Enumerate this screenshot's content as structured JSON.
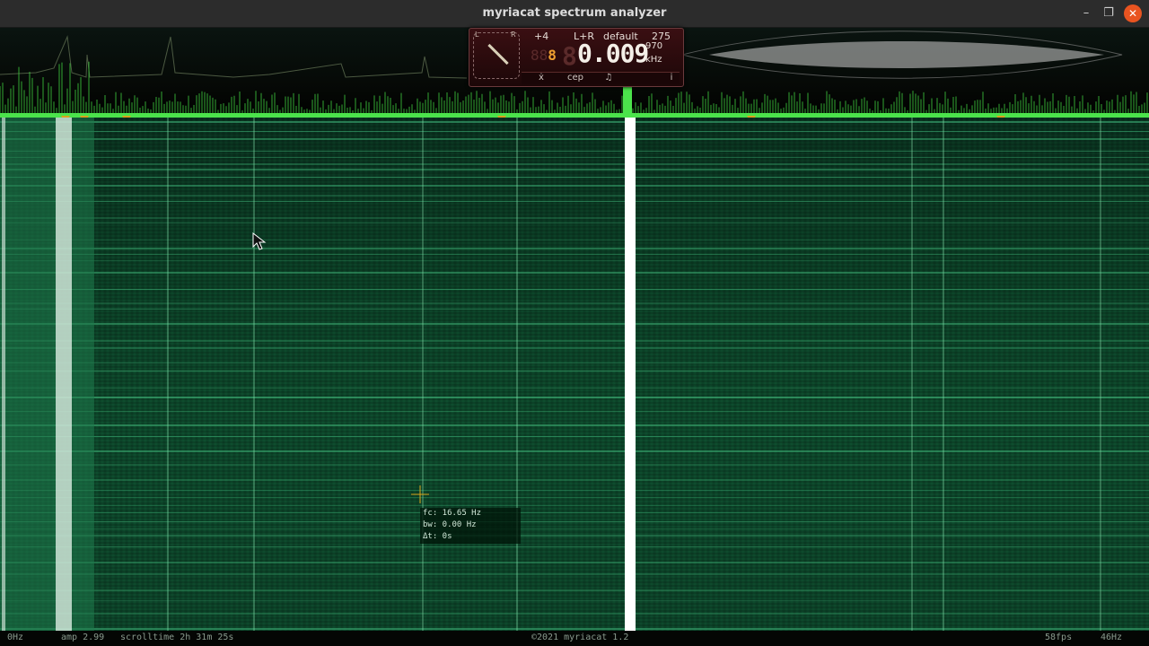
{
  "window": {
    "title": "myriacat spectrum analyzer",
    "minimize_glyph": "–",
    "maximize_glyph": "❐",
    "close_glyph": "✕"
  },
  "hud": {
    "dial_left": "L",
    "dial_right": "R",
    "gain": "+4",
    "channel": "L+R",
    "preset": "default",
    "preset_value": "275",
    "segment_digits": "88",
    "segment_active": "8",
    "ghost_digit": "8",
    "main_value": "0.009",
    "sub_value": "970",
    "unit": "kHz",
    "btn_mode": "ẋ",
    "btn_cep": "cep",
    "btn_note": "♫",
    "btn_info": "i"
  },
  "tooltip": {
    "fc": "fc: 16.65 Hz",
    "bw": "bw: 0.00 Hz",
    "dt": "Δt: 0s"
  },
  "status": {
    "left_freq": "0Hz",
    "amp": "amp 2.99",
    "scrolltime": "scrolltime 2h 31m 25s",
    "copyright": "©2021 myriacat 1.2",
    "fps": "58fps",
    "right_freq": "46Hz"
  },
  "colors": {
    "accent_green": "#4be34b",
    "waterfall_green": "#0f5533",
    "marker_orange": "#d9a21b",
    "close_button": "#e95420"
  }
}
